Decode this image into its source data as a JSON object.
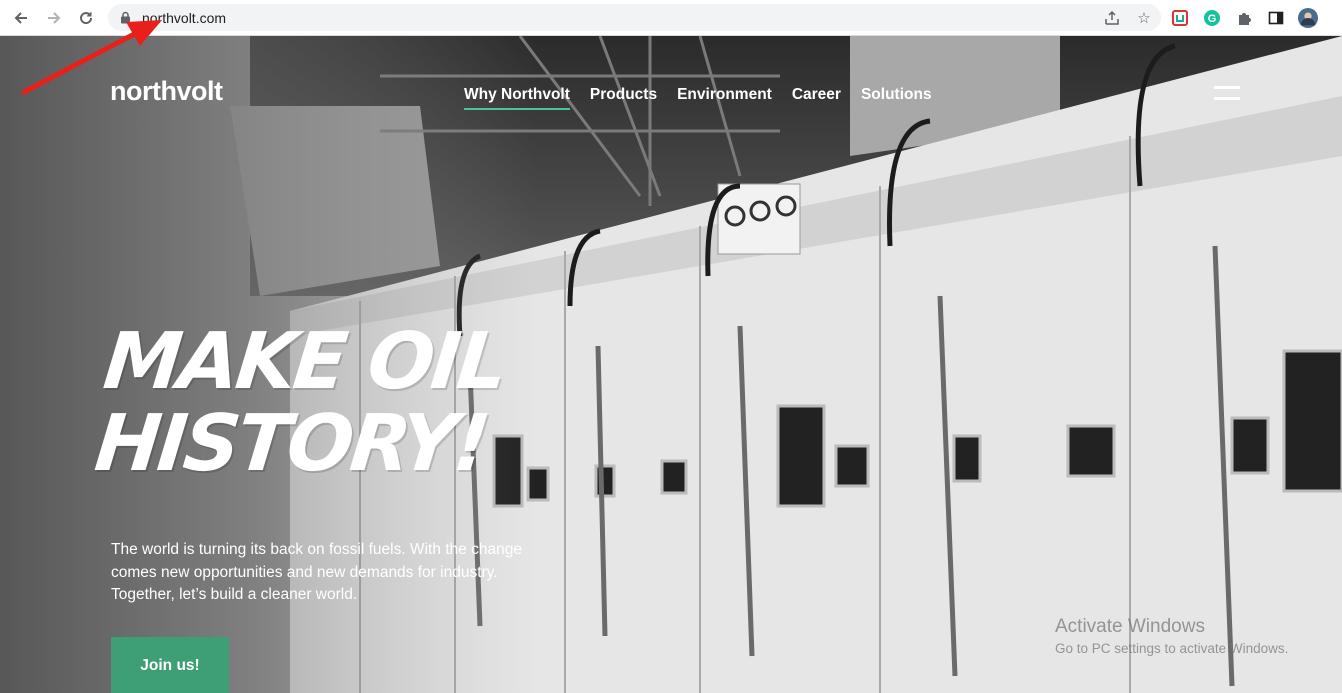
{
  "browser": {
    "url": "northvolt.com",
    "icons": {
      "back": "arrow-left-icon",
      "forward": "arrow-right-icon",
      "reload": "reload-icon",
      "lock": "lock-icon",
      "share": "share-icon",
      "bookmark": "star-icon",
      "extensions": [
        "adblock-extension-icon",
        "grammarly-extension-icon",
        "puzzle-extensions-icon",
        "sidepanel-icon",
        "profile-avatar"
      ]
    }
  },
  "site": {
    "logo": "northvolt",
    "nav": [
      {
        "label": "Why Northvolt",
        "active": true
      },
      {
        "label": "Products",
        "active": false
      },
      {
        "label": "Environment",
        "active": false
      },
      {
        "label": "Career",
        "active": false
      },
      {
        "label": "Solutions",
        "active": false
      }
    ],
    "headline": [
      "MAKE OIL",
      "HISTORY!"
    ],
    "intro": "The world is turning its back on fossil fuels. With the change comes new opportunities and new demands for industry. Together, let’s build a cleaner world.",
    "cta": "Join us!",
    "accent_color": "#3e9e74",
    "underline_color": "#4cc497"
  },
  "os_watermark": {
    "title": "Activate Windows",
    "subtitle": "Go to PC settings to activate Windows."
  },
  "annotation": {
    "arrow_color": "#e8201c",
    "points_to": "address bar url"
  }
}
